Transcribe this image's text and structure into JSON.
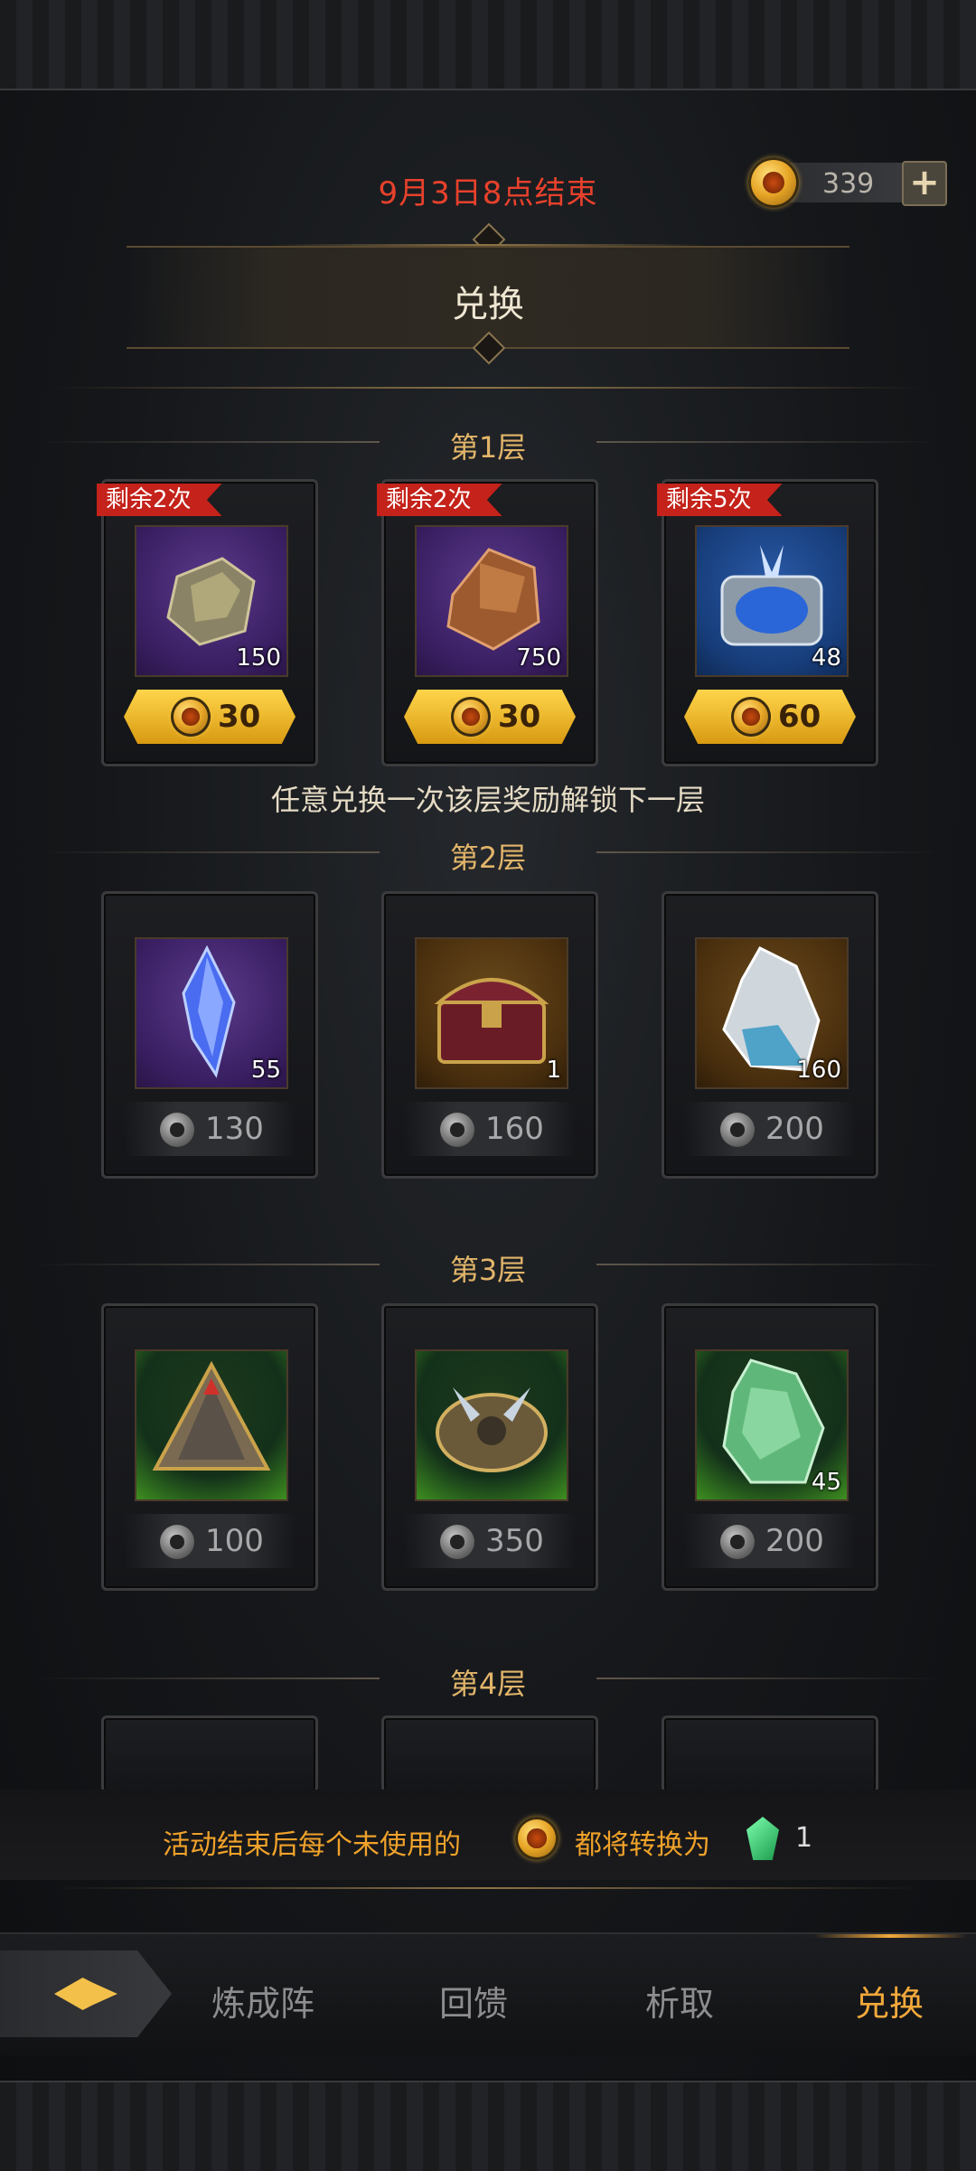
{
  "header": {
    "deadline": "9月3日8点结束",
    "currency_amount": "339",
    "add_label": "+",
    "title": "兑换"
  },
  "tiers": [
    {
      "label": "第1层",
      "items": [
        {
          "badge": "剩余2次",
          "qty": "150",
          "price": "30",
          "price_type": "gold",
          "thumb": "purple",
          "icon": "ore-stone-icon"
        },
        {
          "badge": "剩余2次",
          "qty": "750",
          "price": "30",
          "price_type": "gold",
          "thumb": "purple",
          "icon": "copper-ore-icon"
        },
        {
          "badge": "剩余5次",
          "qty": "48",
          "price": "60",
          "price_type": "gold",
          "thumb": "blue",
          "icon": "crystal-chest-icon"
        }
      ],
      "hint": "任意兑换一次该层奖励解锁下一层"
    },
    {
      "label": "第2层",
      "items": [
        {
          "qty": "55",
          "price": "130",
          "price_type": "gray",
          "thumb": "purple",
          "icon": "blue-crystal-icon"
        },
        {
          "qty": "1",
          "price": "160",
          "price_type": "gray",
          "thumb": "orange",
          "icon": "treasure-chest-icon"
        },
        {
          "qty": "160",
          "price": "200",
          "price_type": "gray",
          "thumb": "orange",
          "icon": "ice-ore-icon"
        }
      ]
    },
    {
      "label": "第3层",
      "items": [
        {
          "qty": "",
          "price": "100",
          "price_type": "gray",
          "thumb": "green",
          "icon": "pyramid-relic-icon"
        },
        {
          "qty": "",
          "price": "350",
          "price_type": "gray",
          "thumb": "green",
          "icon": "spiked-armor-icon"
        },
        {
          "qty": "45",
          "price": "200",
          "price_type": "gray",
          "thumb": "green",
          "icon": "green-ore-icon"
        }
      ]
    },
    {
      "label": "第4层",
      "items": []
    }
  ],
  "notice": {
    "prefix": "活动结束后每个未使用的",
    "middle": "都将转换为",
    "amount": "1"
  },
  "nav": {
    "tabs": [
      "炼成阵",
      "回馈",
      "析取",
      "兑换"
    ],
    "active": "兑换"
  },
  "colors": {
    "deadline": "#e8412c",
    "tier_label": "#e2b56a",
    "badge": "#c4221a",
    "price_gold": "#ffd54a",
    "notice": "#f0a22a",
    "active_tab": "#f3a93b"
  }
}
